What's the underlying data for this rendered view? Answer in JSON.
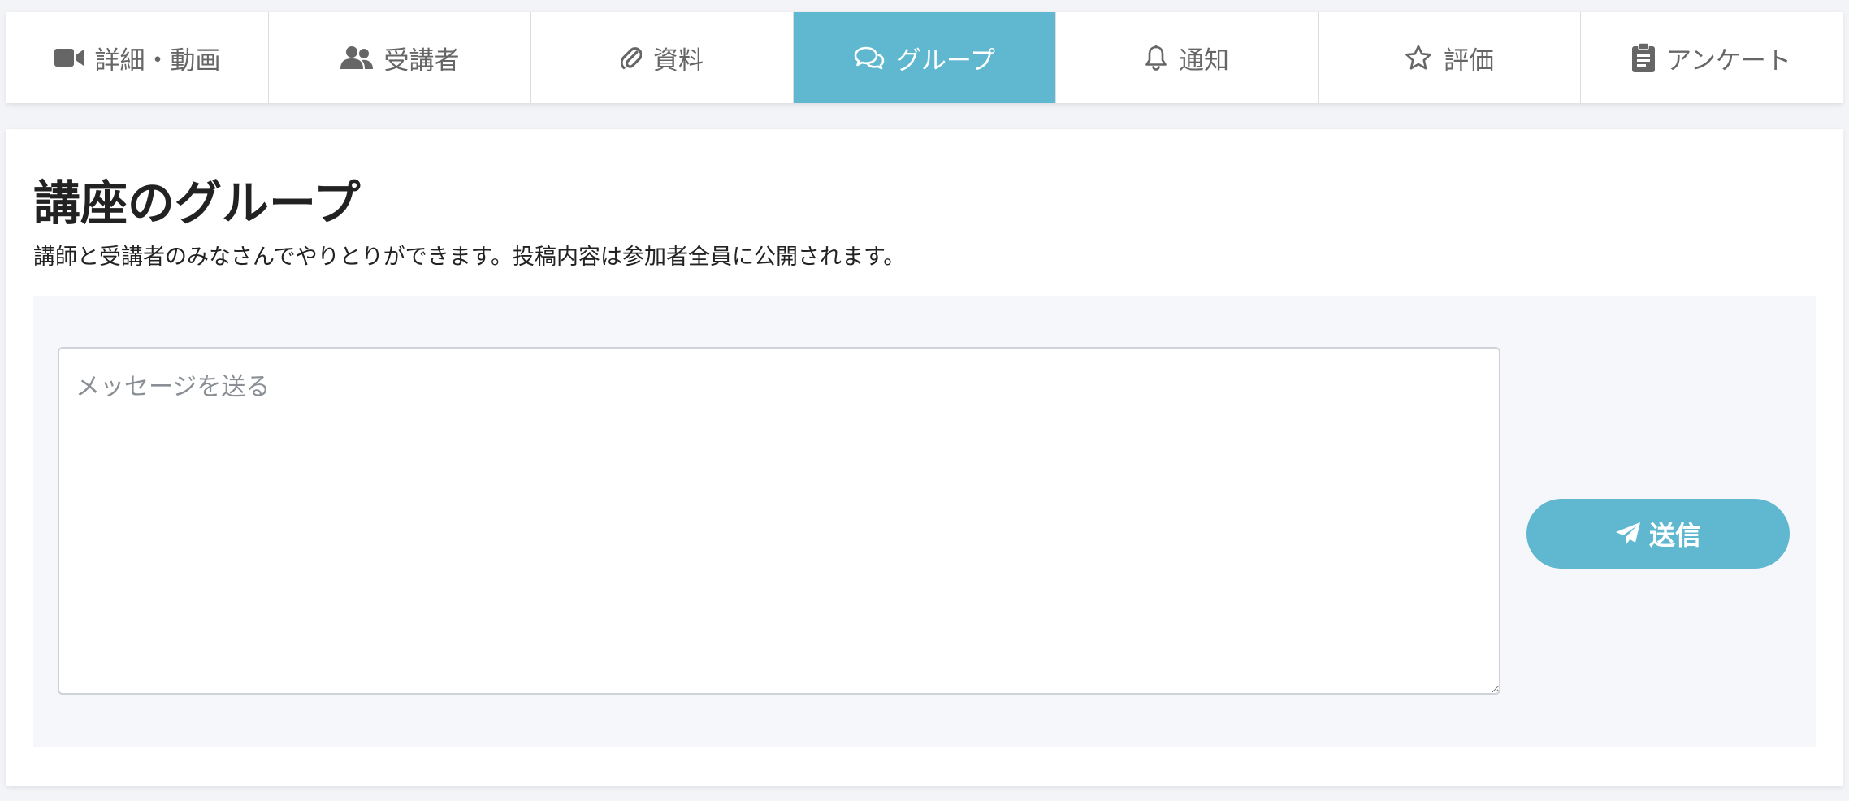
{
  "tabs": [
    {
      "label": "詳細・動画",
      "icon": "video-camera-icon",
      "active": false
    },
    {
      "label": "受講者",
      "icon": "users-icon",
      "active": false
    },
    {
      "label": "資料",
      "icon": "paperclip-icon",
      "active": false
    },
    {
      "label": "グループ",
      "icon": "chat-bubbles-icon",
      "active": true
    },
    {
      "label": "通知",
      "icon": "bell-icon",
      "active": false
    },
    {
      "label": "評価",
      "icon": "star-icon",
      "active": false
    },
    {
      "label": "アンケート",
      "icon": "clipboard-icon",
      "active": false
    }
  ],
  "main": {
    "title": "講座のグループ",
    "description": "講師と受講者のみなさんでやりとりができます。投稿内容は参加者全員に公開されます。"
  },
  "compose": {
    "placeholder": "メッセージを送る",
    "value": "",
    "send_label": "送信",
    "send_icon": "paper-plane-icon"
  },
  "colors": {
    "accent": "#5fb8cf",
    "tab_text": "#666666",
    "background": "#f3f4f7"
  }
}
